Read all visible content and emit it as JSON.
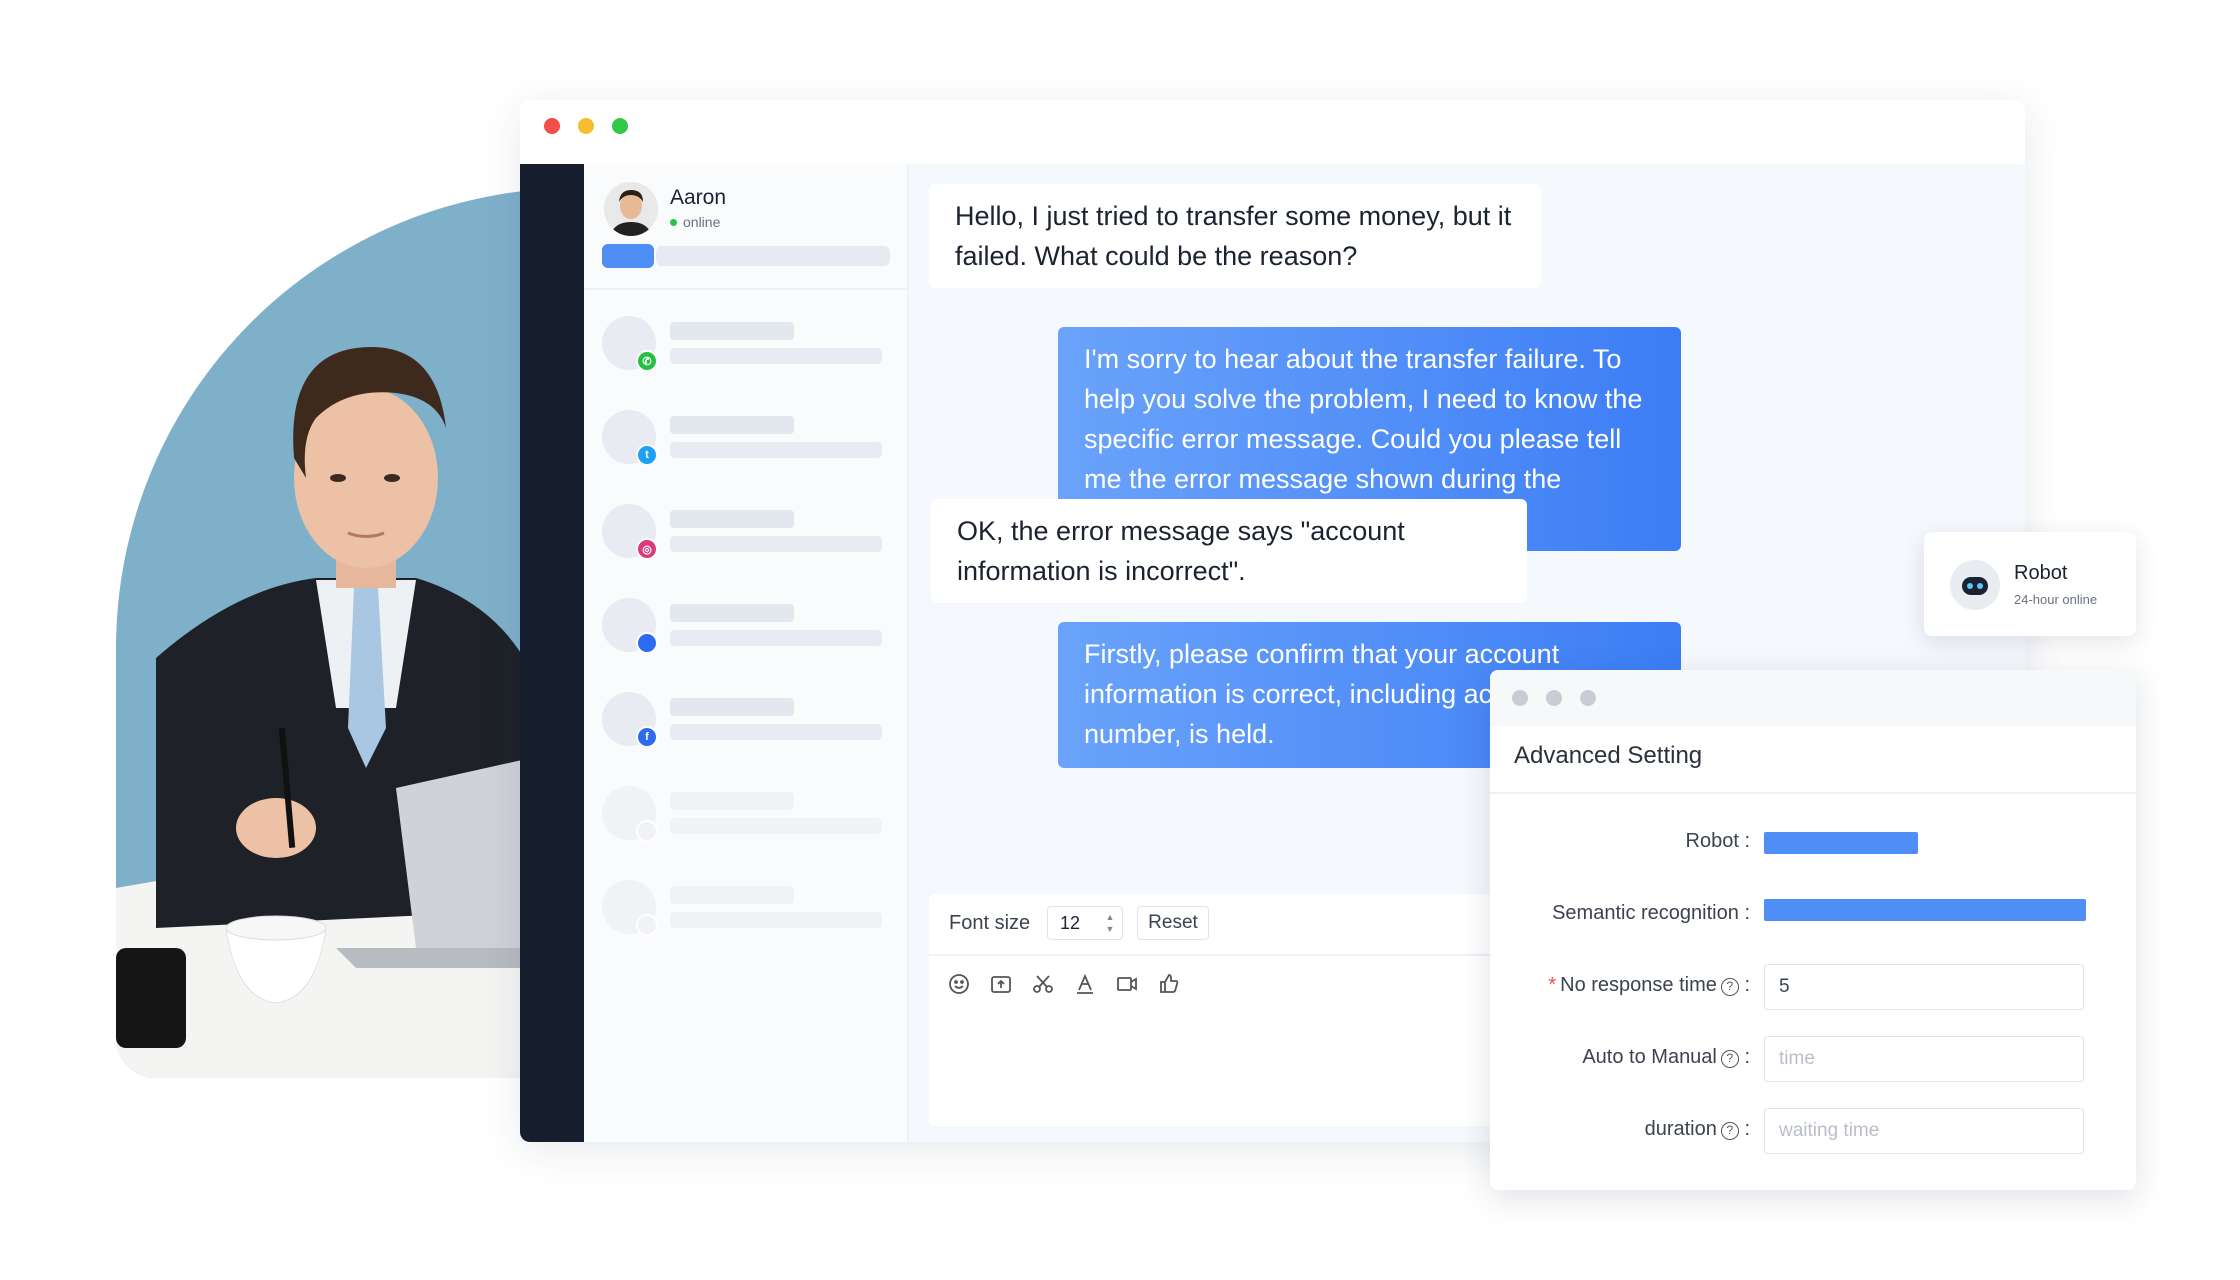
{
  "window": {
    "controls": [
      "close",
      "minimize",
      "maximize"
    ]
  },
  "active_contact": {
    "name": "Aaron",
    "status": "online"
  },
  "conversation_list": [
    {
      "channel": "whatsapp",
      "icon": "whatsapp-icon",
      "color": "#25c043"
    },
    {
      "channel": "twitter",
      "icon": "twitter-icon",
      "color": "#1da1f2"
    },
    {
      "channel": "instagram",
      "icon": "instagram-icon",
      "color": "#d93a7c"
    },
    {
      "channel": "messenger",
      "icon": "messenger-icon",
      "color": "#2d6cf0"
    },
    {
      "channel": "facebook",
      "icon": "facebook-icon",
      "color": "#2d6cf0"
    },
    {
      "channel": "",
      "icon": "",
      "color": ""
    },
    {
      "channel": "",
      "icon": "",
      "color": ""
    }
  ],
  "messages": [
    {
      "direction": "in",
      "text": "Hello, I just tried to transfer some money, but it failed. What could be the reason?"
    },
    {
      "direction": "out",
      "text": "I'm sorry to hear about the transfer failure. To help you solve the problem, I need to know the specific error message. Could you please tell me the error message shown during the transfer?"
    },
    {
      "direction": "in",
      "text": "OK, the error message says \"account information is incorrect\"."
    },
    {
      "direction": "out",
      "text": "Firstly, please confirm that your account information is correct, including account number, is held."
    }
  ],
  "composer": {
    "font_size_label": "Font size",
    "font_size_value": "12",
    "reset_label": "Reset",
    "toolbar_icons": [
      "emoji-icon",
      "upload-icon",
      "scissors-icon",
      "text-format-icon",
      "video-icon",
      "thumbs-up-icon"
    ]
  },
  "robot_card": {
    "name": "Robot",
    "status": "24-hour online"
  },
  "advanced_setting": {
    "title": "Advanced Setting",
    "robot_label": "Robot",
    "semantic_label": "Semantic recognition",
    "no_response_label": "No response time",
    "no_response_value": "5",
    "auto_manual_label": "Auto to Manual",
    "auto_manual_placeholder": "time",
    "duration_label": "duration",
    "duration_placeholder": "waiting time",
    "separator": ":",
    "accent_color": "#4f8ef7"
  },
  "colors": {
    "accent": "#4f8ef7",
    "rail": "#161e2e",
    "chat_background": "#f5f8fc"
  }
}
